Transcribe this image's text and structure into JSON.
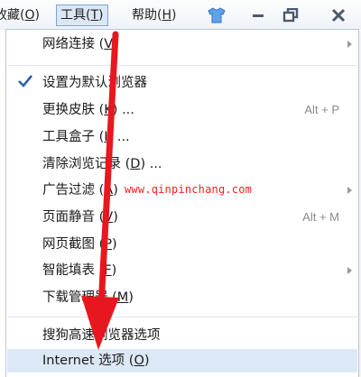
{
  "menubar": {
    "favorites_label": "收藏(",
    "favorites_key": "O",
    "favorites_close": ")",
    "tools_label": "工具(",
    "tools_key": "T",
    "tools_close": ")",
    "help_label": "帮助(",
    "help_key": "H",
    "help_close": ")"
  },
  "menu": {
    "items": [
      {
        "label": "网络连接 (",
        "key": "V",
        "tail": ")",
        "shortcut": "",
        "submenu": true
      },
      {
        "label": "设置为默认浏览器",
        "key": "",
        "tail": "",
        "shortcut": "",
        "checked": true
      },
      {
        "label": "更换皮肤 (",
        "key": "K",
        "tail": ") ...",
        "shortcut": "Alt + P"
      },
      {
        "label": "工具盒子 (",
        "key": "I",
        "tail": ") ...",
        "shortcut": ""
      },
      {
        "label": "清除浏览记录 (",
        "key": "D",
        "tail": ") ...",
        "shortcut": ""
      },
      {
        "label": "广告过滤 (",
        "key": "A",
        "tail": ")",
        "shortcut": "",
        "submenu": true
      },
      {
        "label": "页面静音 (",
        "key": "V",
        "tail": ")",
        "shortcut": "Alt + M"
      },
      {
        "label": "网页截图 (",
        "key": "P",
        "tail": ")",
        "shortcut": ""
      },
      {
        "label": "智能填表 (",
        "key": "F",
        "tail": ")",
        "shortcut": "",
        "submenu": true
      },
      {
        "label": "下载管理器 (",
        "key": "M",
        "tail": ")",
        "shortcut": ""
      },
      {
        "label": "搜狗高速浏览器选项",
        "key": "",
        "tail": "",
        "shortcut": ""
      },
      {
        "label": "Internet 选项 (",
        "key": "O",
        "tail": ")",
        "shortcut": "",
        "highlighted": true
      }
    ]
  },
  "watermark": "www.qinpinchang.com",
  "colors": {
    "accent_highlight": "#dce8f6",
    "annotation_arrow": "#e8171f",
    "check": "#2f5fa8"
  }
}
